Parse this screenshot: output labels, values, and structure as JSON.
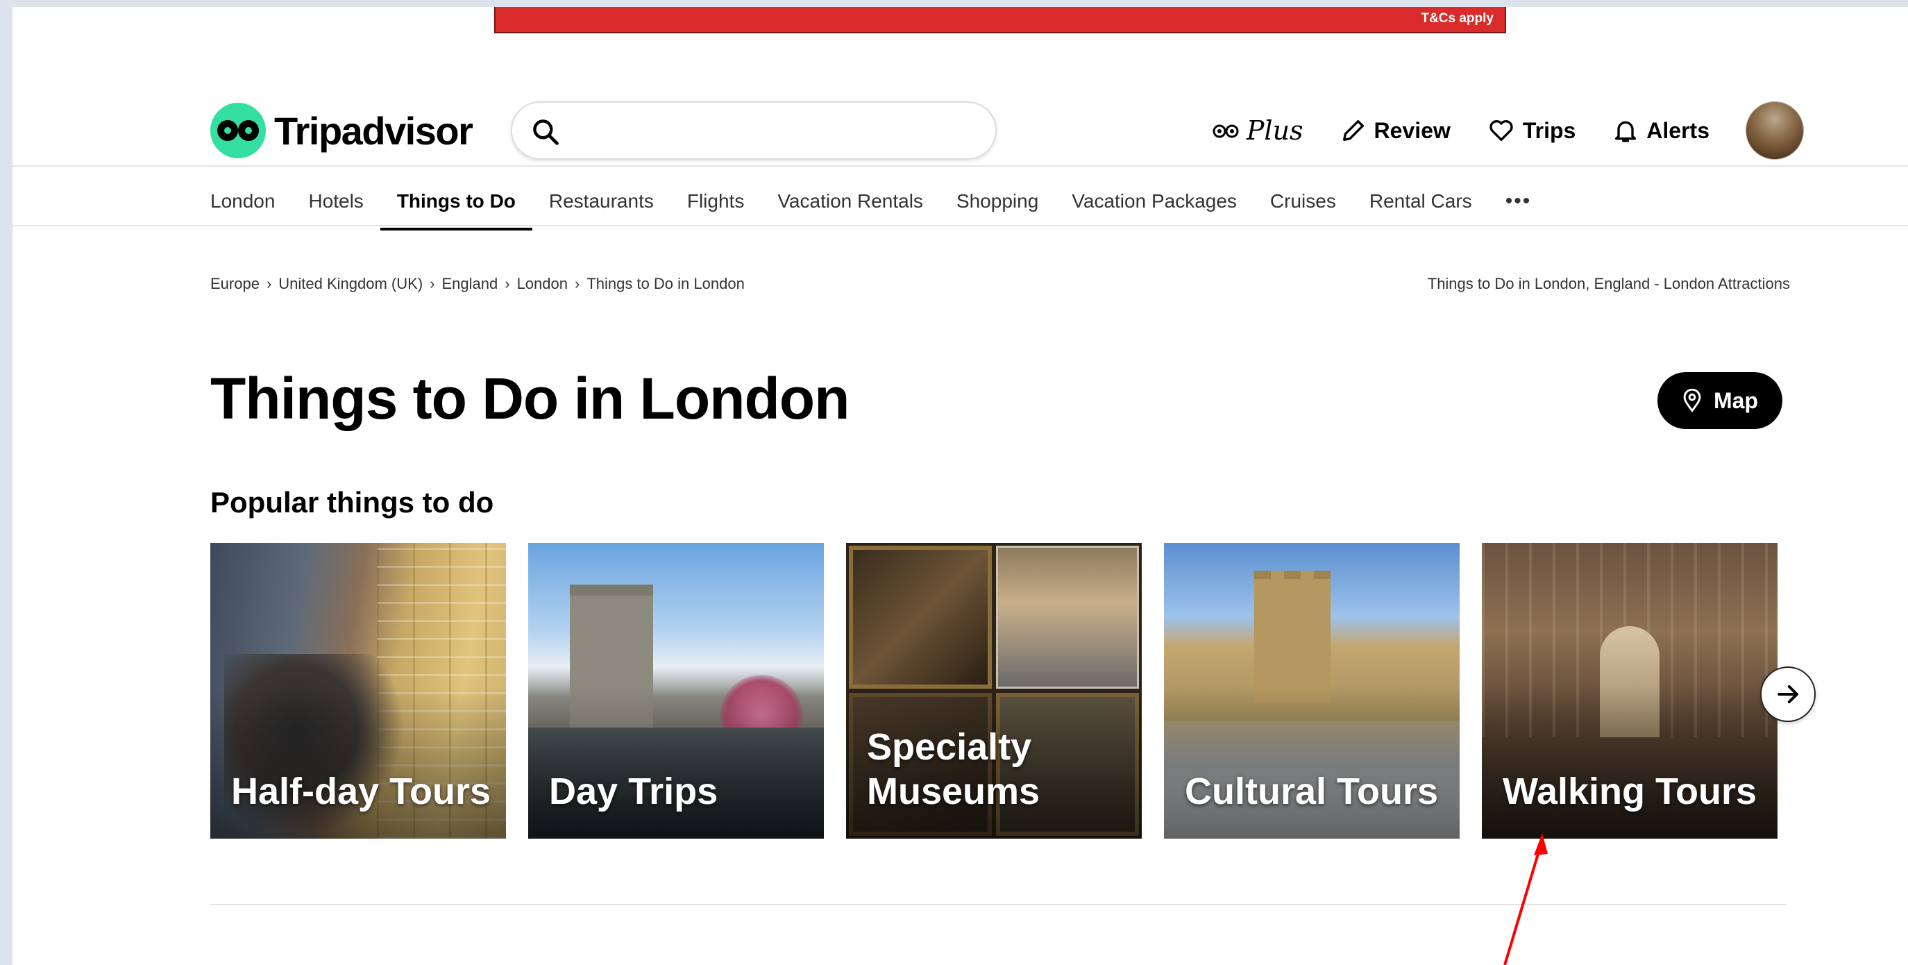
{
  "promo": {
    "tc_text": "T&Cs apply"
  },
  "brand": {
    "name": "Tripadvisor",
    "color": "#34e0a1"
  },
  "search": {
    "placeholder": "",
    "value": ""
  },
  "header_nav": {
    "plus_label": "Plus",
    "review_label": "Review",
    "trips_label": "Trips",
    "alerts_label": "Alerts"
  },
  "tabs": [
    {
      "label": "London"
    },
    {
      "label": "Hotels"
    },
    {
      "label": "Things to Do",
      "active": true
    },
    {
      "label": "Restaurants"
    },
    {
      "label": "Flights"
    },
    {
      "label": "Vacation Rentals"
    },
    {
      "label": "Shopping"
    },
    {
      "label": "Vacation Packages"
    },
    {
      "label": "Cruises"
    },
    {
      "label": "Rental Cars"
    },
    {
      "label": "•••"
    }
  ],
  "breadcrumb": [
    {
      "label": "Europe"
    },
    {
      "label": "United Kingdom (UK)"
    },
    {
      "label": "England"
    },
    {
      "label": "London"
    },
    {
      "label": "Things to Do in London"
    }
  ],
  "page_subtitle": "Things to Do in London, England - London Attractions",
  "page_title": "Things to Do in London",
  "map_button": {
    "label": "Map"
  },
  "section": {
    "title": "Popular things to do"
  },
  "cards": [
    {
      "label": "Half-day Tours"
    },
    {
      "label": "Day Trips"
    },
    {
      "label": "Specialty Museums"
    },
    {
      "label": "Cultural Tours"
    },
    {
      "label": "Walking Tours"
    }
  ],
  "colors": {
    "promo_red": "#d92b2b",
    "annotation_red": "#ff0000"
  }
}
